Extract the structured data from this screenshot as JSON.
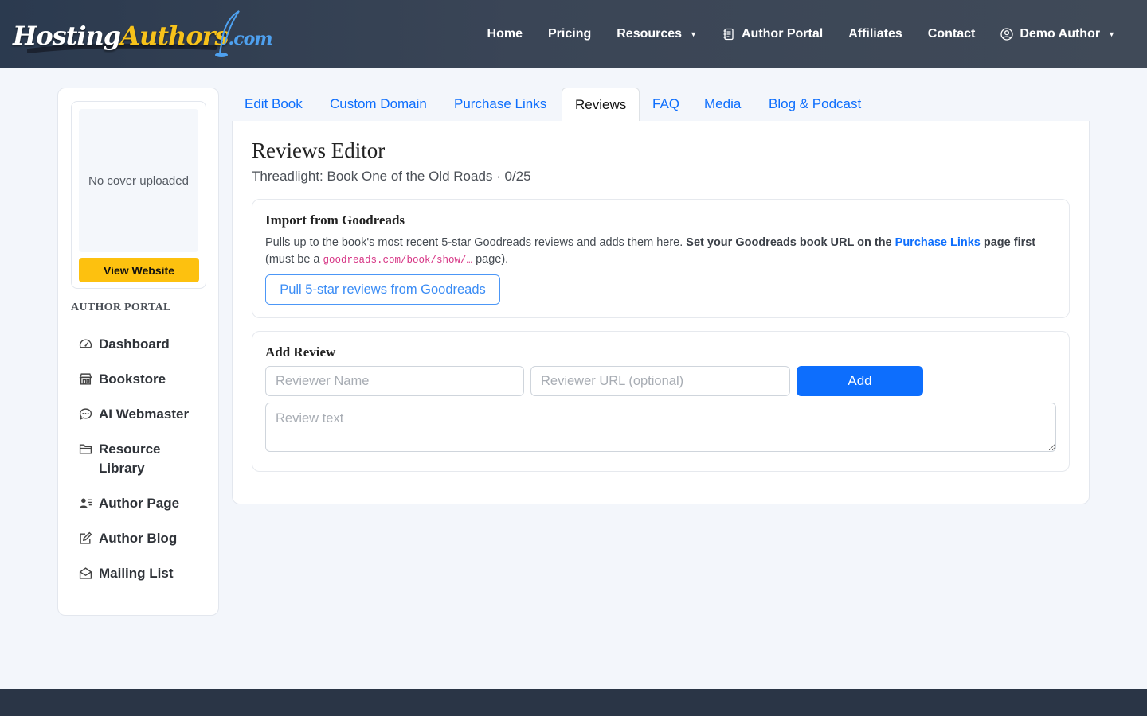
{
  "brand": {
    "part1": "Hosting",
    "part2": "Authors",
    "part3": ".com"
  },
  "nav": {
    "home": "Home",
    "pricing": "Pricing",
    "resources": "Resources",
    "author_portal": "Author Portal",
    "affiliates": "Affiliates",
    "contact": "Contact",
    "user": "Demo Author"
  },
  "sidebar": {
    "cover_placeholder": "No cover uploaded",
    "view_website": "View Website",
    "heading": "AUTHOR PORTAL",
    "items": [
      {
        "label": "Dashboard",
        "icon": "speedometer-icon"
      },
      {
        "label": "Bookstore",
        "icon": "shop-icon"
      },
      {
        "label": "AI Webmaster",
        "icon": "chat-icon"
      },
      {
        "label": "Resource Library",
        "icon": "folder-icon"
      },
      {
        "label": "Author Page",
        "icon": "person-lines-icon"
      },
      {
        "label": "Author Blog",
        "icon": "pencil-square-icon"
      },
      {
        "label": "Mailing List",
        "icon": "envelope-open-icon"
      }
    ]
  },
  "tabs": [
    {
      "label": "Edit Book"
    },
    {
      "label": "Custom Domain"
    },
    {
      "label": "Purchase Links"
    },
    {
      "label": "Reviews",
      "active": true
    },
    {
      "label": "FAQ"
    },
    {
      "label": "Media"
    },
    {
      "label": "Blog & Podcast"
    }
  ],
  "main": {
    "title": "Reviews Editor",
    "subtitle": "Threadlight: Book One of the Old Roads · 0/25"
  },
  "import": {
    "title": "Import from Goodreads",
    "desc_plain": "Pulls up to the book's most recent 5-star Goodreads reviews and adds them here. ",
    "desc_bold_before": "Set your Goodreads book URL on the ",
    "desc_link": "Purchase Links",
    "desc_bold_after": " page first",
    "desc_paren_start": "(must be a ",
    "desc_code": "goodreads.com/book/show/…",
    "desc_paren_end": " page).",
    "button": "Pull 5-star reviews from Goodreads"
  },
  "add_review": {
    "title": "Add Review",
    "name_placeholder": "Reviewer Name",
    "url_placeholder": "Reviewer URL (optional)",
    "add_button": "Add",
    "text_placeholder": "Review text"
  },
  "colors": {
    "primary": "#0d6efd",
    "accent_yellow": "#fdc10f",
    "header_dark": "#2b3a4f",
    "footer": "#2a3546"
  }
}
